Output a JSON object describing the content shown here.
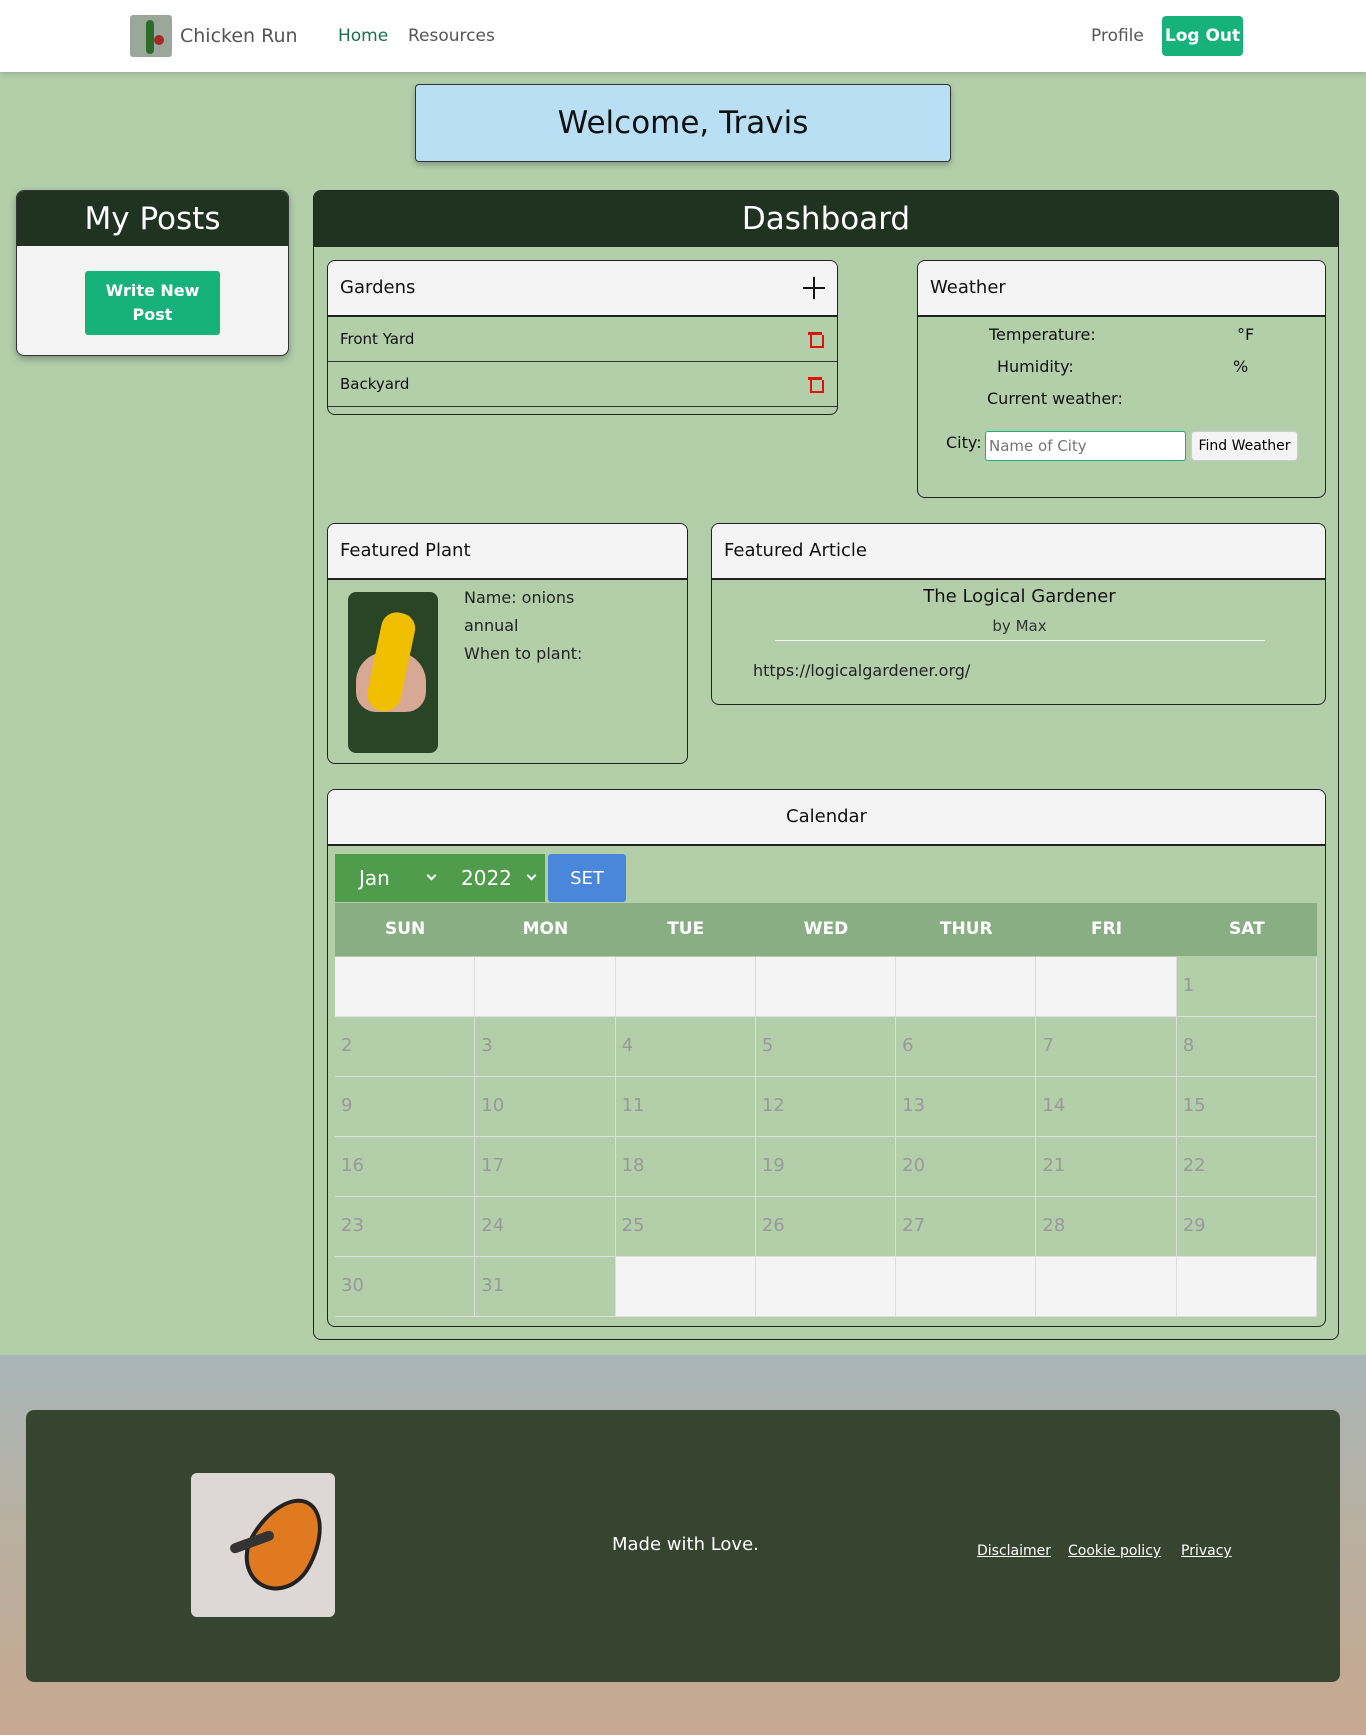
{
  "nav": {
    "brand": "Chicken Run",
    "home": "Home",
    "resources": "Resources",
    "profile": "Profile",
    "logout": "Log Out"
  },
  "welcome": "Welcome, Travis",
  "my_posts": {
    "title": "My Posts",
    "write_button": "Write New Post"
  },
  "dashboard": {
    "title": "Dashboard",
    "gardens": {
      "title": "Gardens",
      "items": [
        "Front Yard",
        "Backyard"
      ]
    },
    "weather": {
      "title": "Weather",
      "temperature_label": "Temperature:",
      "temperature_unit": "°F",
      "humidity_label": "Humidity:",
      "humidity_unit": "%",
      "current_label": "Current weather:",
      "city_label": "City:",
      "city_placeholder": "Name of City",
      "find_button": "Find Weather"
    },
    "featured_plant": {
      "title": "Featured Plant",
      "name": "Name: onions",
      "type": "annual",
      "when": "When to plant:"
    },
    "featured_article": {
      "title": "Featured Article",
      "article_title": "The Logical Gardener",
      "author": "by Max",
      "url": "https://logicalgardener.org/"
    },
    "calendar": {
      "title": "Calendar",
      "month": "Jan",
      "year": "2022",
      "set_button": "SET",
      "days": [
        "SUN",
        "MON",
        "TUE",
        "WED",
        "THUR",
        "FRI",
        "SAT"
      ],
      "cells": [
        "",
        "",
        "",
        "",
        "",
        "",
        "1",
        "2",
        "3",
        "4",
        "5",
        "6",
        "7",
        "8",
        "9",
        "10",
        "11",
        "12",
        "13",
        "14",
        "15",
        "16",
        "17",
        "18",
        "19",
        "20",
        "21",
        "22",
        "23",
        "24",
        "25",
        "26",
        "27",
        "28",
        "29",
        "30",
        "31",
        "",
        "",
        "",
        "",
        ""
      ]
    }
  },
  "footer": {
    "tagline": "Made with Love.",
    "links": [
      "Disclaimer",
      "Cookie policy",
      "Privacy"
    ]
  },
  "colors": {
    "background": "#b2cfaa",
    "header_dark": "#203321",
    "accent_green": "#17b27c",
    "welcome_blue": "#b9dff5",
    "footer_dark": "#374530",
    "set_blue": "#4a86d9",
    "delete_red": "#e01010"
  },
  "icons": {
    "add": "plus-icon",
    "delete": "trash-icon",
    "select": "chevron-down-icon"
  }
}
